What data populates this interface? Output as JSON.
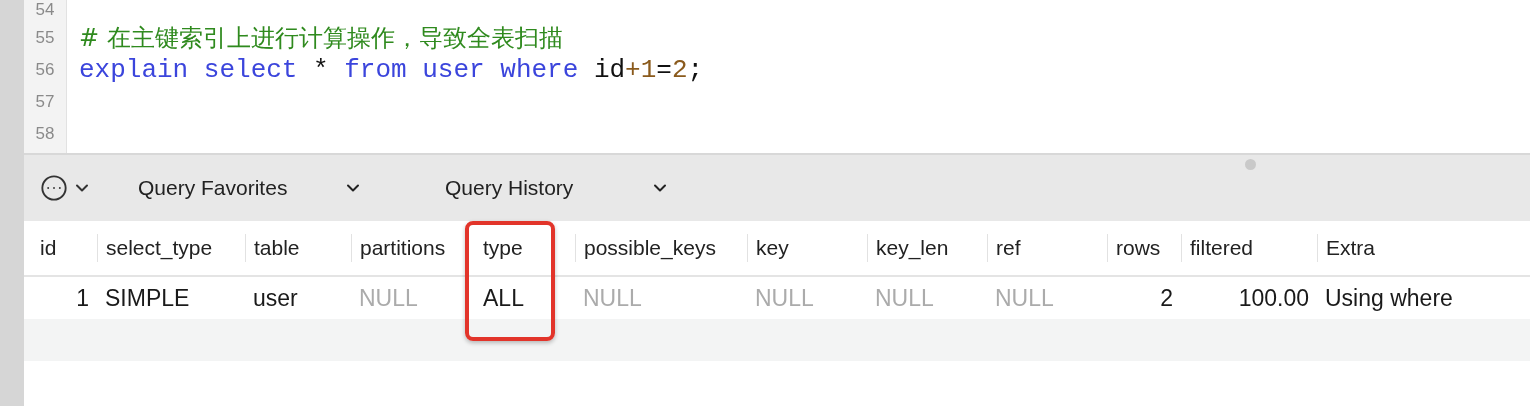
{
  "editor": {
    "lines": [
      {
        "number": "54"
      },
      {
        "number": "55",
        "tokens": [
          {
            "kind": "comment",
            "text": "# 在主键索引上进行计算操作，导致全表扫描"
          }
        ]
      },
      {
        "number": "56",
        "tokens": [
          {
            "kind": "keyword",
            "text": "explain select"
          },
          {
            "kind": "plain",
            "text": " * "
          },
          {
            "kind": "keyword",
            "text": "from user where"
          },
          {
            "kind": "plain",
            "text": " id"
          },
          {
            "kind": "number",
            "text": "+1"
          },
          {
            "kind": "plain",
            "text": "="
          },
          {
            "kind": "number",
            "text": "2"
          },
          {
            "kind": "plain",
            "text": ";"
          }
        ]
      },
      {
        "number": "57"
      },
      {
        "number": "58"
      }
    ]
  },
  "toolbar": {
    "menus": [
      {
        "label": "Query Favorites"
      },
      {
        "label": "Query History"
      }
    ]
  },
  "results": {
    "columns": [
      {
        "label": "id",
        "highlighted": false
      },
      {
        "label": "select_type",
        "highlighted": false
      },
      {
        "label": "table",
        "highlighted": false
      },
      {
        "label": "partitions",
        "highlighted": false
      },
      {
        "label": "type",
        "highlighted": true
      },
      {
        "label": "possible_keys",
        "highlighted": false
      },
      {
        "label": "key",
        "highlighted": false
      },
      {
        "label": "key_len",
        "highlighted": false
      },
      {
        "label": "ref",
        "highlighted": false
      },
      {
        "label": "rows",
        "highlighted": false
      },
      {
        "label": "filtered",
        "highlighted": false
      },
      {
        "label": "Extra",
        "highlighted": false
      }
    ],
    "rows": [
      {
        "cells": [
          {
            "kind": "number",
            "text": "1"
          },
          {
            "kind": "text",
            "text": "SIMPLE"
          },
          {
            "kind": "text",
            "text": "user"
          },
          {
            "kind": "null",
            "text": "NULL"
          },
          {
            "kind": "text",
            "text": "ALL"
          },
          {
            "kind": "null",
            "text": "NULL"
          },
          {
            "kind": "null",
            "text": "NULL"
          },
          {
            "kind": "null",
            "text": "NULL"
          },
          {
            "kind": "null",
            "text": "NULL"
          },
          {
            "kind": "number",
            "text": "2"
          },
          {
            "kind": "number",
            "text": "100.00"
          },
          {
            "kind": "text",
            "text": "Using where"
          }
        ]
      }
    ]
  }
}
